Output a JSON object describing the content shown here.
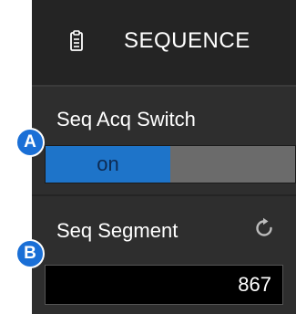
{
  "header": {
    "title": "SEQUENCE",
    "icon": "clipboard-list-icon"
  },
  "seq_acq_switch": {
    "label": "Seq Acq Switch",
    "on_label": "on",
    "state": "on",
    "on_color": "#1e74c9",
    "off_color": "#6b6b6b"
  },
  "seq_segment": {
    "label": "Seq Segment",
    "value": "867",
    "reset_icon": "reset-icon"
  },
  "callouts": {
    "a": "A",
    "b": "B",
    "color": "#1a6fd6"
  }
}
